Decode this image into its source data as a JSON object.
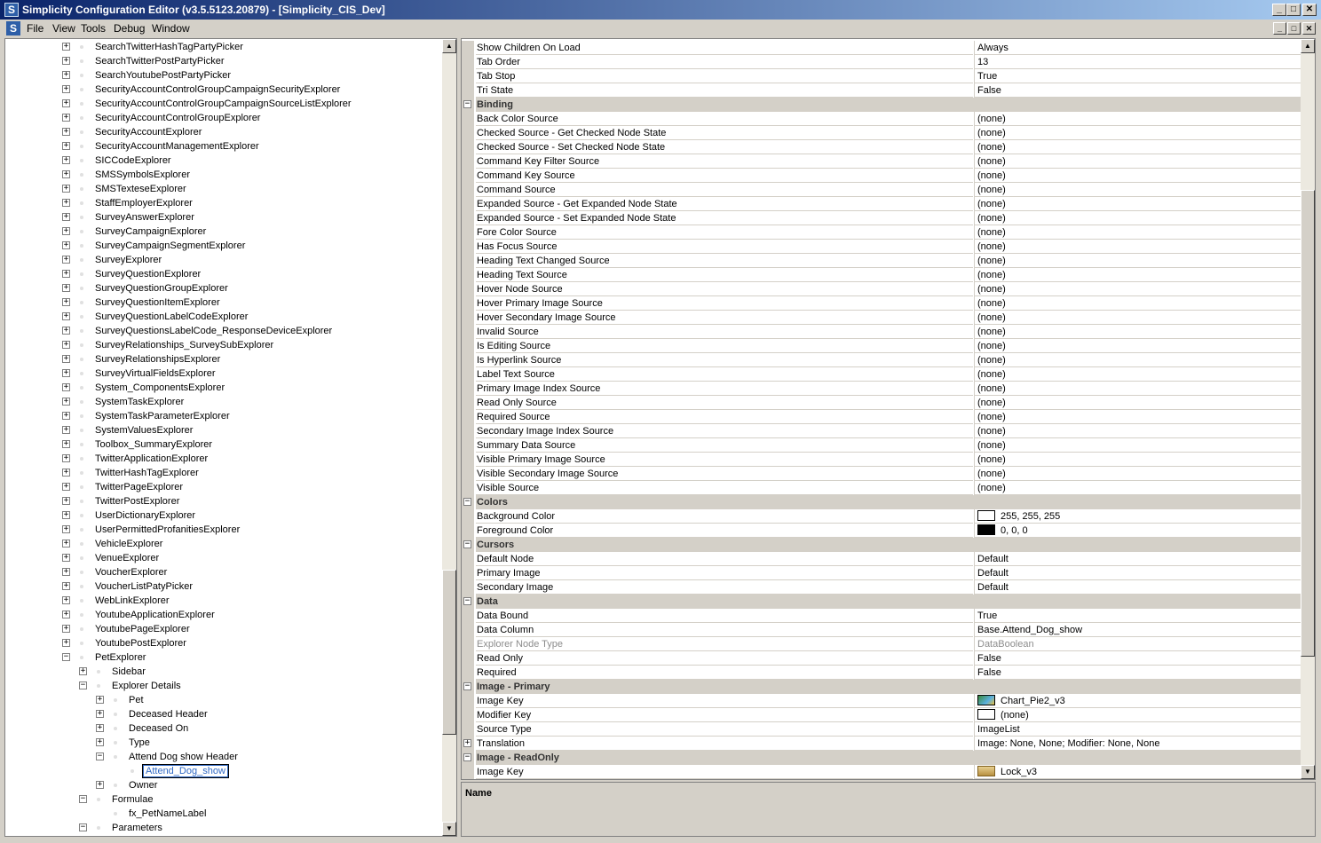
{
  "window": {
    "title": "Simplicity Configuration Editor (v3.5.5123.20879) - [Simplicity_CIS_Dev]",
    "icon_letter": "S",
    "minimize_glyph": "_",
    "maximize_glyph": "□",
    "close_glyph": "✕"
  },
  "menu": {
    "items": [
      "File",
      "View",
      "Tools",
      "Debug",
      "Window"
    ]
  },
  "tree": {
    "items": [
      {
        "label": "SearchTwitterHashTagPartyPicker",
        "depth": 0,
        "exp": "+"
      },
      {
        "label": "SearchTwitterPostPartyPicker",
        "depth": 0,
        "exp": "+"
      },
      {
        "label": "SearchYoutubePostPartyPicker",
        "depth": 0,
        "exp": "+"
      },
      {
        "label": "SecurityAccountControlGroupCampaignSecurityExplorer",
        "depth": 0,
        "exp": "+"
      },
      {
        "label": "SecurityAccountControlGroupCampaignSourceListExplorer",
        "depth": 0,
        "exp": "+"
      },
      {
        "label": "SecurityAccountControlGroupExplorer",
        "depth": 0,
        "exp": "+"
      },
      {
        "label": "SecurityAccountExplorer",
        "depth": 0,
        "exp": "+"
      },
      {
        "label": "SecurityAccountManagementExplorer",
        "depth": 0,
        "exp": "+"
      },
      {
        "label": "SICCodeExplorer",
        "depth": 0,
        "exp": "+"
      },
      {
        "label": "SMSSymbolsExplorer",
        "depth": 0,
        "exp": "+"
      },
      {
        "label": "SMSTexteseExplorer",
        "depth": 0,
        "exp": "+"
      },
      {
        "label": "StaffEmployerExplorer",
        "depth": 0,
        "exp": "+"
      },
      {
        "label": "SurveyAnswerExplorer",
        "depth": 0,
        "exp": "+"
      },
      {
        "label": "SurveyCampaignExplorer",
        "depth": 0,
        "exp": "+"
      },
      {
        "label": "SurveyCampaignSegmentExplorer",
        "depth": 0,
        "exp": "+"
      },
      {
        "label": "SurveyExplorer",
        "depth": 0,
        "exp": "+"
      },
      {
        "label": "SurveyQuestionExplorer",
        "depth": 0,
        "exp": "+"
      },
      {
        "label": "SurveyQuestionGroupExplorer",
        "depth": 0,
        "exp": "+"
      },
      {
        "label": "SurveyQuestionItemExplorer",
        "depth": 0,
        "exp": "+"
      },
      {
        "label": "SurveyQuestionLabelCodeExplorer",
        "depth": 0,
        "exp": "+"
      },
      {
        "label": "SurveyQuestionsLabelCode_ResponseDeviceExplorer",
        "depth": 0,
        "exp": "+"
      },
      {
        "label": "SurveyRelationships_SurveySubExplorer",
        "depth": 0,
        "exp": "+"
      },
      {
        "label": "SurveyRelationshipsExplorer",
        "depth": 0,
        "exp": "+"
      },
      {
        "label": "SurveyVirtualFieldsExplorer",
        "depth": 0,
        "exp": "+"
      },
      {
        "label": "System_ComponentsExplorer",
        "depth": 0,
        "exp": "+"
      },
      {
        "label": "SystemTaskExplorer",
        "depth": 0,
        "exp": "+"
      },
      {
        "label": "SystemTaskParameterExplorer",
        "depth": 0,
        "exp": "+"
      },
      {
        "label": "SystemValuesExplorer",
        "depth": 0,
        "exp": "+"
      },
      {
        "label": "Toolbox_SummaryExplorer",
        "depth": 0,
        "exp": "+"
      },
      {
        "label": "TwitterApplicationExplorer",
        "depth": 0,
        "exp": "+"
      },
      {
        "label": "TwitterHashTagExplorer",
        "depth": 0,
        "exp": "+"
      },
      {
        "label": "TwitterPageExplorer",
        "depth": 0,
        "exp": "+"
      },
      {
        "label": "TwitterPostExplorer",
        "depth": 0,
        "exp": "+"
      },
      {
        "label": "UserDictionaryExplorer",
        "depth": 0,
        "exp": "+"
      },
      {
        "label": "UserPermittedProfanitiesExplorer",
        "depth": 0,
        "exp": "+"
      },
      {
        "label": "VehicleExplorer",
        "depth": 0,
        "exp": "+"
      },
      {
        "label": "VenueExplorer",
        "depth": 0,
        "exp": "+"
      },
      {
        "label": "VoucherExplorer",
        "depth": 0,
        "exp": "+"
      },
      {
        "label": "VoucherListPatyPicker",
        "depth": 0,
        "exp": "+"
      },
      {
        "label": "WebLinkExplorer",
        "depth": 0,
        "exp": "+"
      },
      {
        "label": "YoutubeApplicationExplorer",
        "depth": 0,
        "exp": "+"
      },
      {
        "label": "YoutubePageExplorer",
        "depth": 0,
        "exp": "+"
      },
      {
        "label": "YoutubePostExplorer",
        "depth": 0,
        "exp": "+"
      },
      {
        "label": "PetExplorer",
        "depth": 0,
        "exp": "−"
      },
      {
        "label": "Sidebar",
        "depth": 1,
        "exp": "+"
      },
      {
        "label": "Explorer Details",
        "depth": 1,
        "exp": "−"
      },
      {
        "label": "Pet",
        "depth": 2,
        "exp": "+"
      },
      {
        "label": "Deceased Header",
        "depth": 2,
        "exp": "+"
      },
      {
        "label": "Deceased On",
        "depth": 2,
        "exp": "+"
      },
      {
        "label": "Type",
        "depth": 2,
        "exp": "+"
      },
      {
        "label": "Attend Dog show Header",
        "depth": 2,
        "exp": "−"
      },
      {
        "label": "Attend_Dog_show",
        "depth": 3,
        "exp": "",
        "selected": true
      },
      {
        "label": "Owner",
        "depth": 2,
        "exp": "+"
      },
      {
        "label": "Formulae",
        "depth": 1,
        "exp": "−"
      },
      {
        "label": "fx_PetNameLabel",
        "depth": 2,
        "exp": ""
      },
      {
        "label": "Parameters",
        "depth": 1,
        "exp": "−"
      }
    ]
  },
  "properties": {
    "rows": [
      {
        "name": "Show Children On Load",
        "value": "Always"
      },
      {
        "name": "Tab Order",
        "value": "13"
      },
      {
        "name": "Tab Stop",
        "value": "True"
      },
      {
        "name": "Tri State",
        "value": "False"
      },
      {
        "category": "Binding"
      },
      {
        "name": "Back Color Source",
        "value": "(none)"
      },
      {
        "name": "Checked Source - Get Checked Node State",
        "value": "(none)"
      },
      {
        "name": "Checked Source - Set Checked Node State",
        "value": "(none)"
      },
      {
        "name": "Command Key Filter Source",
        "value": "(none)"
      },
      {
        "name": "Command Key Source",
        "value": "(none)"
      },
      {
        "name": "Command Source",
        "value": "(none)"
      },
      {
        "name": "Expanded Source - Get Expanded Node State",
        "value": "(none)"
      },
      {
        "name": "Expanded Source - Set Expanded Node State",
        "value": "(none)"
      },
      {
        "name": "Fore Color Source",
        "value": "(none)"
      },
      {
        "name": "Has Focus Source",
        "value": "(none)"
      },
      {
        "name": "Heading Text Changed Source",
        "value": "(none)"
      },
      {
        "name": "Heading Text Source",
        "value": "(none)"
      },
      {
        "name": "Hover Node Source",
        "value": "(none)"
      },
      {
        "name": "Hover Primary Image Source",
        "value": "(none)"
      },
      {
        "name": "Hover Secondary Image Source",
        "value": "(none)"
      },
      {
        "name": "Invalid Source",
        "value": "(none)"
      },
      {
        "name": "Is Editing Source",
        "value": "(none)"
      },
      {
        "name": "Is Hyperlink Source",
        "value": "(none)"
      },
      {
        "name": "Label Text Source",
        "value": "(none)"
      },
      {
        "name": "Primary Image Index Source",
        "value": "(none)"
      },
      {
        "name": "Read Only Source",
        "value": "(none)"
      },
      {
        "name": "Required Source",
        "value": "(none)"
      },
      {
        "name": "Secondary Image Index Source",
        "value": "(none)"
      },
      {
        "name": "Summary Data Source",
        "value": "(none)"
      },
      {
        "name": "Visible Primary Image Source",
        "value": "(none)"
      },
      {
        "name": "Visible Secondary Image Source",
        "value": "(none)"
      },
      {
        "name": "Visible Source",
        "value": "(none)"
      },
      {
        "category": "Colors"
      },
      {
        "name": "Background Color",
        "value": "255, 255, 255",
        "swatch": "#ffffff"
      },
      {
        "name": "Foreground Color",
        "value": "0, 0, 0",
        "swatch": "#000000"
      },
      {
        "category": "Cursors"
      },
      {
        "name": "Default Node",
        "value": "Default"
      },
      {
        "name": "Primary Image",
        "value": "Default"
      },
      {
        "name": "Secondary Image",
        "value": "Default"
      },
      {
        "category": "Data"
      },
      {
        "name": "Data Bound",
        "value": "True"
      },
      {
        "name": "Data Column",
        "value": "Base.Attend_Dog_show"
      },
      {
        "name": "Explorer Node Type",
        "value": "DataBoolean",
        "disabled": true
      },
      {
        "name": "Read Only",
        "value": "False"
      },
      {
        "name": "Required",
        "value": "False"
      },
      {
        "category": "Image - Primary"
      },
      {
        "name": "Image Key",
        "value": "Chart_Pie2_v3",
        "icon": "chart-icon"
      },
      {
        "name": "Modifier Key",
        "value": "(none)",
        "swatch": "#ffffff"
      },
      {
        "name": "Source Type",
        "value": "ImageList"
      },
      {
        "name": "Translation",
        "value": "Image: None, None; Modifier: None, None",
        "expandable": true
      },
      {
        "category": "Image - ReadOnly"
      },
      {
        "name": "Image Key",
        "value": "Lock_v3",
        "icon": "lock-icon"
      }
    ]
  },
  "description": {
    "title": "Name"
  }
}
